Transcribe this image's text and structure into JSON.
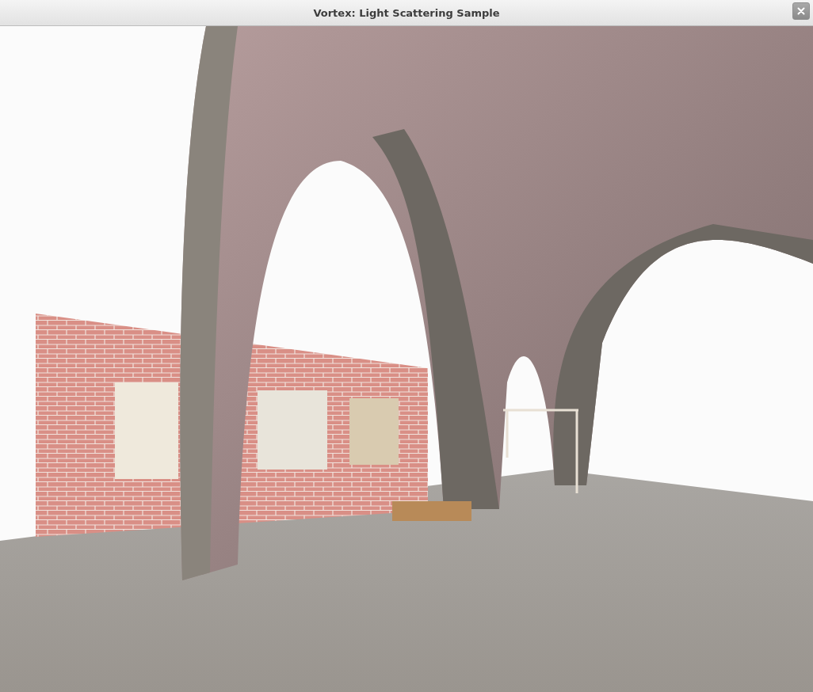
{
  "window": {
    "title": "Vortex: Light Scattering Sample"
  }
}
